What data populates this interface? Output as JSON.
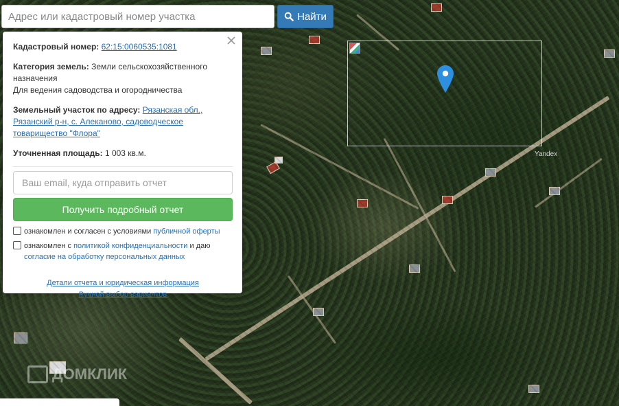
{
  "search": {
    "placeholder": "Адрес или кадастровый номер участка",
    "button_label": "Найти"
  },
  "panel": {
    "cadastral_label": "Кадастровый номер:",
    "cadastral_value": "62:15:0060535:1081",
    "category_label": "Категория земель:",
    "category_value": "Земли сельскохозяйственного назначения",
    "usage_value": "Для ведения садоводства и огородничества",
    "address_label": "Земельный участок по адресу:",
    "address_value": "Рязанская обл., Рязанский р-н, с. Алеканово, садоводческое товарищество \"Флора\"",
    "area_label": "Уточненная площадь:",
    "area_value": "1 003 кв.м.",
    "email_placeholder": "Ваш email, куда отправить отчет",
    "report_button": "Получить подробный отчет",
    "consent1_text": "ознакомлен и согласен с условиями",
    "consent1_link": "публичной оферты",
    "consent2_text": "ознакомлен с",
    "consent2_link1": "политикой конфиденциальности",
    "consent2_and": "и даю",
    "consent2_link2": "согласие на обработку персональных данных",
    "details_link": "Детали отчета и юридическая информация",
    "manual_link": "Ручной выбор вариантов"
  },
  "map": {
    "provider_label": "Yandex",
    "watermark": "ДОМКЛИК",
    "pin_color": "#2d8fe0"
  },
  "colors": {
    "search_button": "#337ab7",
    "report_button": "#5cb85c",
    "link": "#2a6fb0"
  },
  "icons": {
    "search": "search-icon",
    "close": "close-icon",
    "pin": "map-pin-icon"
  }
}
